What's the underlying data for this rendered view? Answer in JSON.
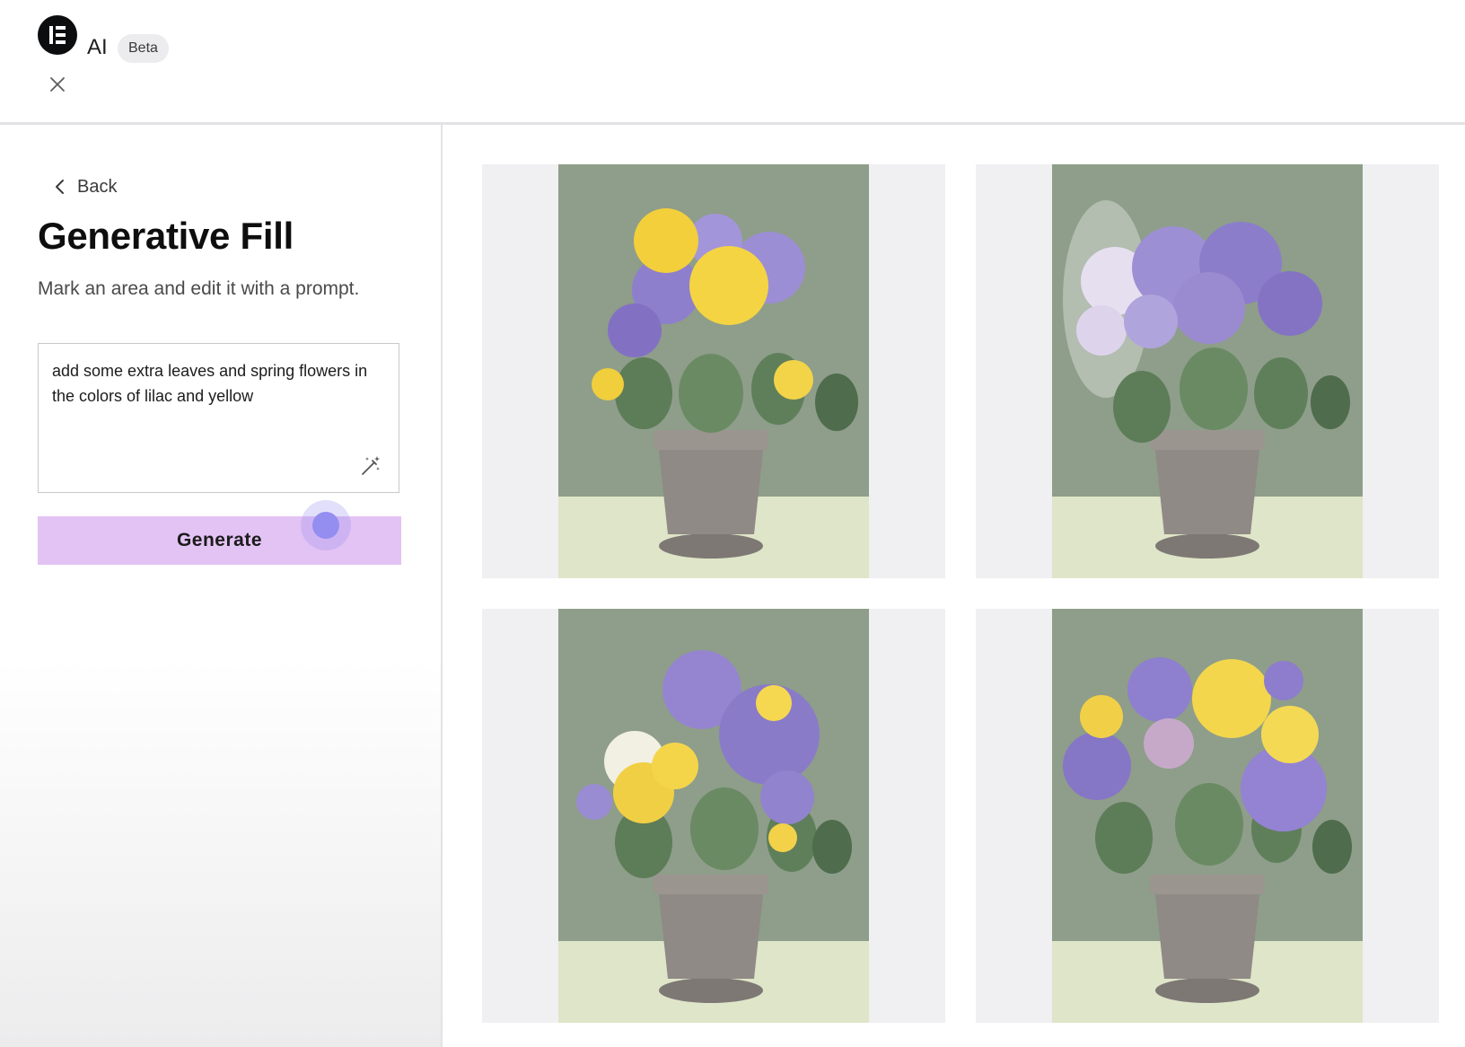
{
  "header": {
    "app_name": "AI",
    "badge": "Beta",
    "logo_icon": "elementor-logo-icon",
    "close_icon": "close-icon"
  },
  "sidebar": {
    "back_label": "Back",
    "title": "Generative Fill",
    "subtitle": "Mark an area and edit it with a prompt.",
    "prompt_value": "add some extra leaves and spring flowers in the colors of lilac and yellow",
    "prompt_icon": "magic-wand-icon",
    "generate_label": "Generate"
  },
  "gallery": {
    "results": [
      {
        "variant": "yellow-and-lilac-blossoms"
      },
      {
        "variant": "lilac-and-white-blossoms"
      },
      {
        "variant": "lilac-and-yellow-roses"
      },
      {
        "variant": "yellow-roses-and-purple-blossoms"
      }
    ]
  },
  "colors": {
    "accent_button": "#e3c3f4",
    "lilac": "#8e7fcc",
    "yellow": "#f2cf3b",
    "backdrop": "#8d9d89",
    "cursor": "#938ef0"
  }
}
